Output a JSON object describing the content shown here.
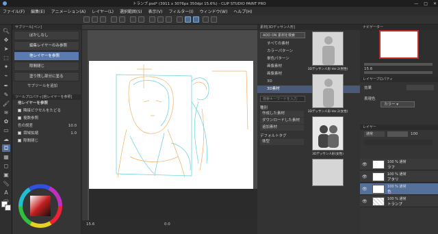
{
  "window": {
    "title": "トランプ.psd* (3911 x 3076px 350dpi 15.6%)  - CLIP STUDIO PAINT PRO",
    "controls": [
      "—",
      "□",
      "✕"
    ]
  },
  "menu": [
    "ファイル(F)",
    "編集(E)",
    "アニメーション(A)",
    "レイヤー(L)",
    "選択範囲(S)",
    "表示(V)",
    "フィルター(I)",
    "ウィンドウ(W)",
    "ヘルプ(H)"
  ],
  "subtool": {
    "header": "サブツール[ペン]",
    "items": [
      "ぼかしなし",
      "編集レイヤーのみ参照",
      "他レイヤーを参照",
      "隙間閉じ",
      "塗り残し部分に塗る"
    ],
    "selected_index": 2,
    "add_label": "サブツールを追加"
  },
  "tool_property": {
    "header": "ツールプロパティ[他レイヤーを参照]",
    "title": "他レイヤーを参照",
    "rows": [
      {
        "label": "隣接ピクセルをたどる",
        "checked": true
      },
      {
        "label": "複数参照",
        "checked": true
      },
      {
        "label": "色の誤差",
        "value": "10.0"
      },
      {
        "label": "領域拡縮",
        "checked": true,
        "value": "1.0"
      },
      {
        "label": "隙間閉じ",
        "checked": true
      }
    ]
  },
  "canvas": {
    "zoom": "15.6",
    "angle": "0.0",
    "status_left": "15.6",
    "status_mid": "0.0"
  },
  "materials": {
    "header": "素材[3Dデッサン人形]",
    "search_btn": "ADD ON 素材を検索",
    "tree": [
      "すべての素材",
      "カラーパターン",
      "単色パターン",
      "画像素材",
      "画像素材",
      "3D",
      "3D素材"
    ],
    "selected_tree_index": 6,
    "keyword_placeholder": "検索キーワードを入力",
    "tags_title": "種別",
    "tags": [
      "作成した素材",
      "ダウンロードした素材",
      "追加素材"
    ],
    "tags2_title": "デフォルトタグ",
    "tags2": [
      "体型"
    ],
    "thumbs": [
      "3Dデッサン人形-Ver.2(男性)",
      "3Dデッサン人形-Ver.2(女性)",
      "3Dデッサン人形(女性)"
    ]
  },
  "navigator": {
    "header": "ナビゲーター",
    "zoom": "15.6",
    "angle": "0.0"
  },
  "layer_property": {
    "header": "レイヤープロパティ",
    "effect_label": "効果",
    "expression_label": "表現色",
    "expression_value": "カラー"
  },
  "layers": {
    "header": "レイヤー",
    "blend_mode": "通常",
    "opacity": "100",
    "rows": [
      {
        "mode": "100 % 通常",
        "name": "ラフ"
      },
      {
        "mode": "100 % 通常",
        "name": "アタリ"
      },
      {
        "mode": "100 % 通常",
        "name": "色"
      },
      {
        "mode": "100 % 通常",
        "name": "トランプ"
      }
    ],
    "selected_index": 2
  },
  "colors": {
    "accent": "#5a7ab0",
    "nav_frame": "#c02a2a",
    "sketch_orange": "#f0b060",
    "sketch_cyan": "#5fd0d8"
  }
}
